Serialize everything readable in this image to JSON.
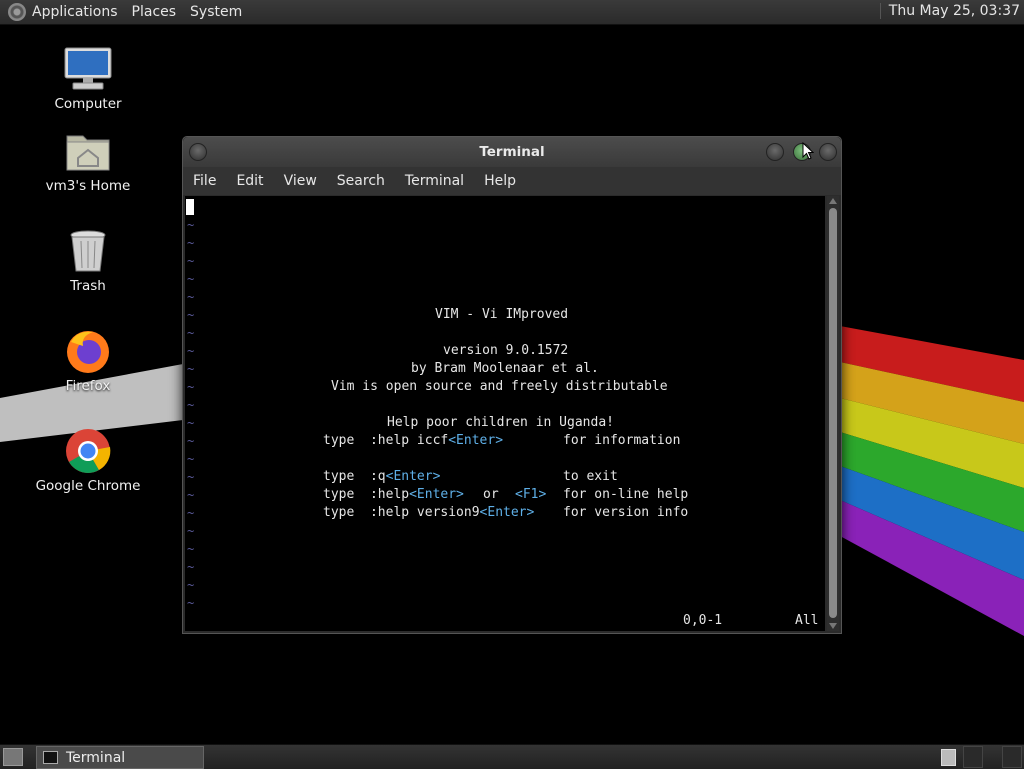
{
  "top_panel": {
    "menus": [
      "Applications",
      "Places",
      "System"
    ],
    "clock": "Thu May 25, 03:37"
  },
  "desktop_icons": [
    {
      "label": "Computer",
      "icon": "computer-icon"
    },
    {
      "label": "vm3's Home",
      "icon": "home-folder-icon"
    },
    {
      "label": "Trash",
      "icon": "trash-icon"
    },
    {
      "label": "Firefox",
      "icon": "firefox-icon"
    },
    {
      "label": "Google Chrome",
      "icon": "chrome-icon"
    }
  ],
  "window": {
    "title": "Terminal",
    "menus": [
      "File",
      "Edit",
      "View",
      "Search",
      "Terminal",
      "Help"
    ]
  },
  "vim": {
    "tilde": "~",
    "title": "VIM - Vi IMproved",
    "version": "version 9.0.1572",
    "author": "by Bram Moolenaar et al.",
    "license": "Vim is open source and freely distributable",
    "help_poor": "Help poor children in Uganda!",
    "cmd_iccf": "type  :help iccf",
    "cmd_iccf_desc": "for information",
    "cmd_quit": "type  :q",
    "cmd_quit_desc": "to exit",
    "cmd_help": "type  :help",
    "cmd_help_or": "or",
    "cmd_help_f1": "<F1>",
    "cmd_help_desc": "for on-line help",
    "cmd_version": "type  :help version9",
    "cmd_version_desc": "for version info",
    "enter_key": "<Enter>",
    "status_pos": "0,0-1",
    "status_all": "All"
  },
  "taskbar": {
    "task_label": "Terminal"
  },
  "colors": {
    "vim_key": "#5fb0e8",
    "vim_tilde": "#5a5a9a"
  }
}
